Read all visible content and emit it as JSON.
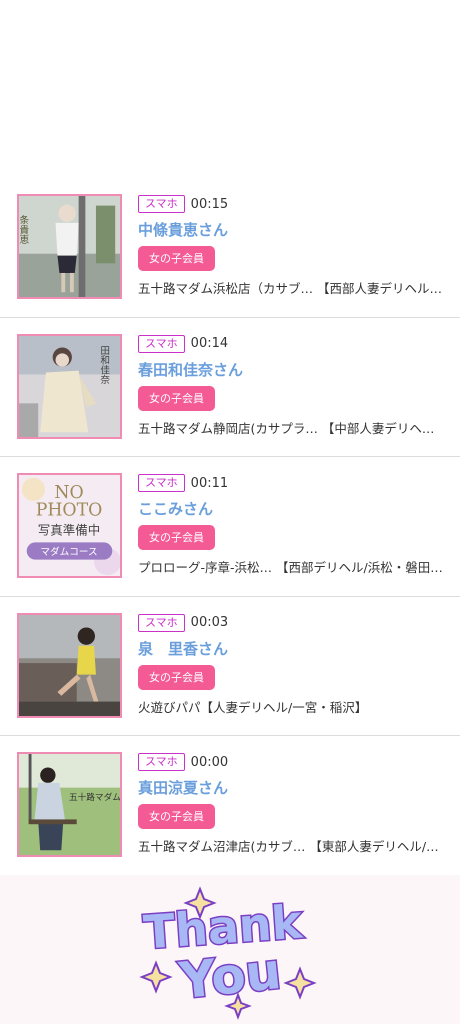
{
  "list": {
    "items": [
      {
        "device": "スマホ",
        "time": "00:15",
        "name": "中條貴恵さん",
        "member": "女の子会員",
        "shop": "五十路マダム浜松店（カサブ… 【西部人妻デリヘル…"
      },
      {
        "device": "スマホ",
        "time": "00:14",
        "name": "春田和佳奈さん",
        "member": "女の子会員",
        "shop": "五十路マダム静岡店(カサプラ… 【中部人妻デリヘ…"
      },
      {
        "device": "スマホ",
        "time": "00:11",
        "name": "ここみさん",
        "member": "女の子会員",
        "shop": "プロローグ-序章-浜松… 【西部デリヘル/浜松・磐田…"
      },
      {
        "device": "スマホ",
        "time": "00:03",
        "name": "泉　里香さん",
        "member": "女の子会員",
        "shop": "火遊びパパ【人妻デリヘル/一宮・稲沢】"
      },
      {
        "device": "スマホ",
        "time": "00:00",
        "name": "真田涼夏さん",
        "member": "女の子会員",
        "shop": "五十路マダム沼津店(カサブ… 【東部人妻デリヘル/…"
      }
    ]
  },
  "thumbs": {
    "photo1_caption": "条貴恵",
    "photo2_caption": "田和佳奈",
    "nophoto_line1": "NO",
    "nophoto_line2": "PHOTO",
    "nophoto_line3": "写真準備中",
    "nophoto_line4": "マダムコース",
    "photo5_caption": "五十路マダム"
  },
  "thanks": {
    "line1": "Thank",
    "line2": "You"
  },
  "colors": {
    "name": "#6a9fdc",
    "device_badge": "#c832c8",
    "member_badge": "#f45b95",
    "thumb_border": "#f08bb4",
    "thanks_fill": "#a8b8f5",
    "thanks_stroke": "#7b3fc4"
  }
}
